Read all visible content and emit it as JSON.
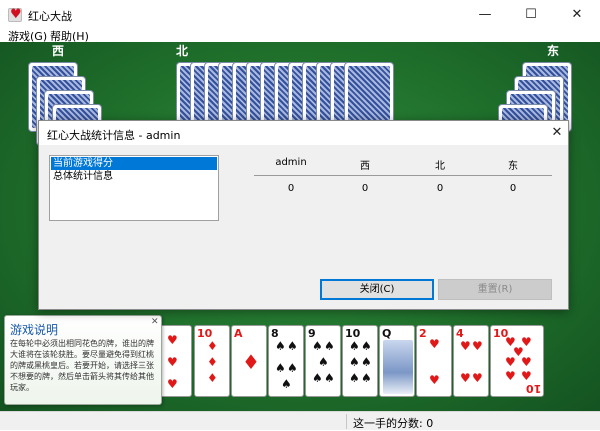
{
  "window": {
    "title": "红心大战",
    "min_label": "—",
    "max_label": "☐",
    "close_label": "✕"
  },
  "menu": [
    {
      "label": "游戏(G)"
    },
    {
      "label": "帮助(H)"
    }
  ],
  "players": {
    "west": "西",
    "north": "北",
    "east": "东"
  },
  "hand": [
    {
      "rank": "",
      "suit": "♥",
      "color": "red"
    },
    {
      "rank": "10",
      "suit": "♦",
      "color": "red"
    },
    {
      "rank": "A",
      "suit": "♦",
      "color": "red"
    },
    {
      "rank": "8",
      "suit": "♠",
      "color": "black"
    },
    {
      "rank": "9",
      "suit": "♠",
      "color": "black"
    },
    {
      "rank": "10",
      "suit": "♠",
      "color": "black"
    },
    {
      "rank": "Q",
      "suit": "♠",
      "color": "black"
    },
    {
      "rank": "2",
      "suit": "♥",
      "color": "red"
    },
    {
      "rank": "4",
      "suit": "♥",
      "color": "red"
    },
    {
      "rank": "10",
      "suit": "♥",
      "color": "red"
    }
  ],
  "dialog": {
    "title": "红心大战统计信息 - admin",
    "close_label": "✕",
    "list": [
      "当前游戏得分",
      "总体统计信息"
    ],
    "headers": [
      "admin",
      "西",
      "北",
      "东"
    ],
    "values": [
      "0",
      "0",
      "0",
      "0"
    ],
    "close_button": "关闭(C)",
    "reset_button": "重置(R)"
  },
  "help": {
    "title": "游戏说明",
    "close_label": "✕",
    "body": "在每轮中必须出相同花色的牌，谁出的牌大谁将在该轮获胜。要尽量避免得到红桃的牌或黑桃皇后。若要开始，请选择三张不想要的牌，然后单击箭头将其传给其他玩家。"
  },
  "status": {
    "score_text": "这一手的分数: 0"
  },
  "colors": {
    "felt": "#1f6f2b",
    "accent": "#0078d7",
    "heart": "#e01818"
  }
}
